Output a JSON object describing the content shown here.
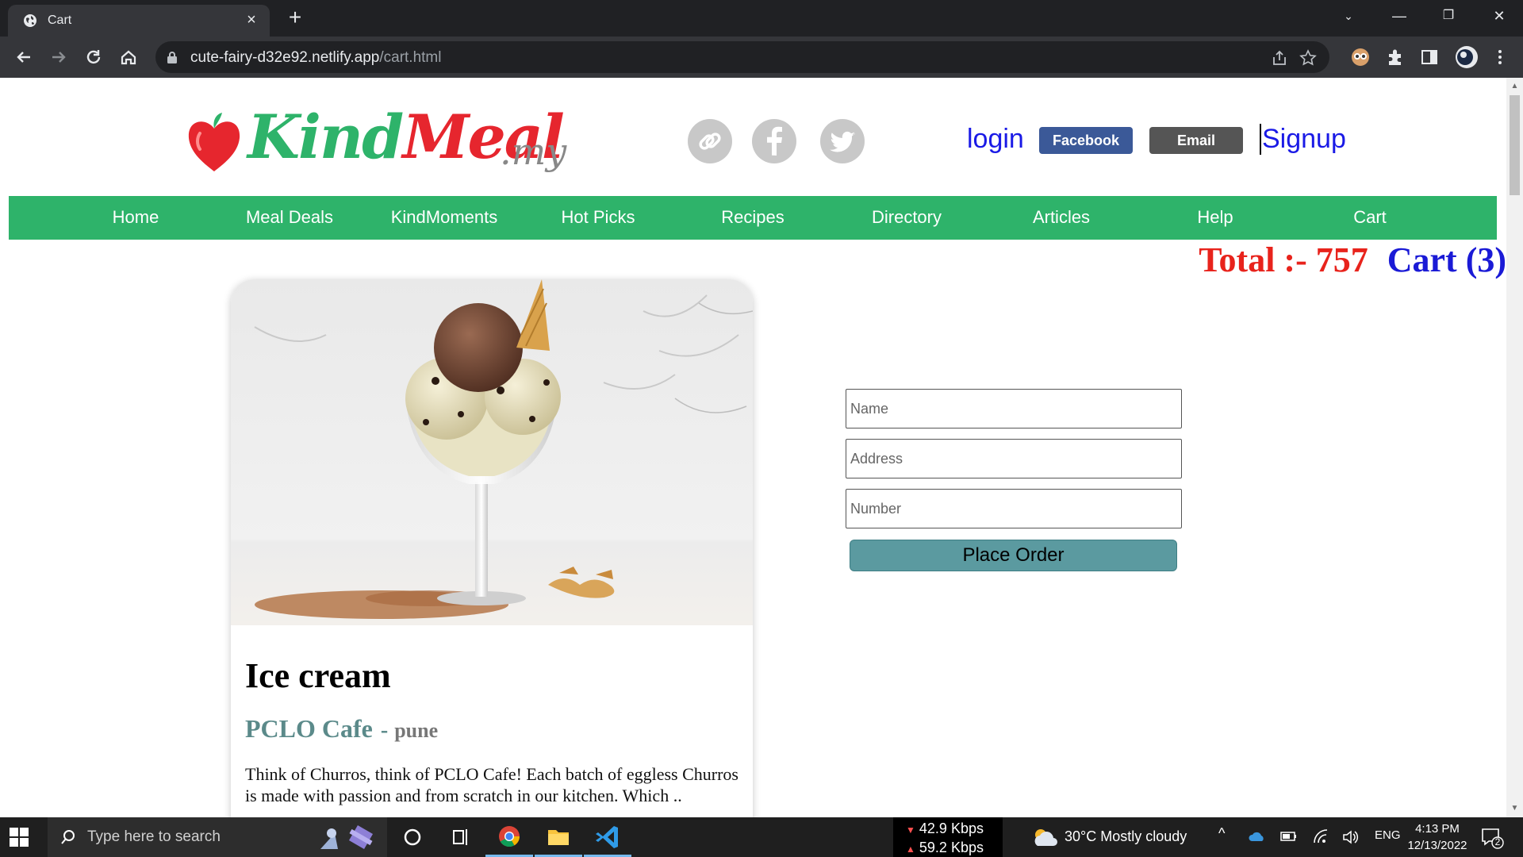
{
  "browser": {
    "tab_title": "Cart",
    "url_host": "cute-fairy-d32e92.netlify.app",
    "url_path": "/cart.html"
  },
  "site": {
    "logo_kind": "Kind",
    "logo_meal": "Meal",
    "logo_suffix": ".my",
    "social_icons": [
      "link-icon",
      "facebook-icon",
      "twitter-icon"
    ],
    "auth": {
      "login": "login",
      "facebook": "Facebook",
      "email": "Email",
      "signup": "Signup"
    },
    "nav": [
      "Home",
      "Meal Deals",
      "KindMoments",
      "Hot Picks",
      "Recipes",
      "Directory",
      "Articles",
      "Help",
      "Cart"
    ],
    "total_label": "Total :- 757",
    "cart_label": "Cart (3)",
    "colors": {
      "brand_green": "#2eb36a",
      "brand_red": "#e6262e",
      "total_red": "#e8231c",
      "cart_blue": "#1a1ad6",
      "button_teal": "#5b9aa0"
    }
  },
  "card": {
    "title": "Ice cream",
    "cafe": "PCLO Cafe",
    "separator": "-",
    "city": "pune",
    "description": "Think of Churros, think of PCLO Cafe! Each batch of eggless Churros is made with passion and from scratch in our kitchen. Which .."
  },
  "form": {
    "name_placeholder": "Name",
    "address_placeholder": "Address",
    "number_placeholder": "Number",
    "submit": "Place Order"
  },
  "taskbar": {
    "search_placeholder": "Type here to search",
    "net_down": "42.9 Kbps",
    "net_up": "59.2 Kbps",
    "weather": "30°C  Mostly cloudy",
    "language": "ENG",
    "time": "4:13 PM",
    "date": "12/13/2022",
    "notifications": "2"
  }
}
